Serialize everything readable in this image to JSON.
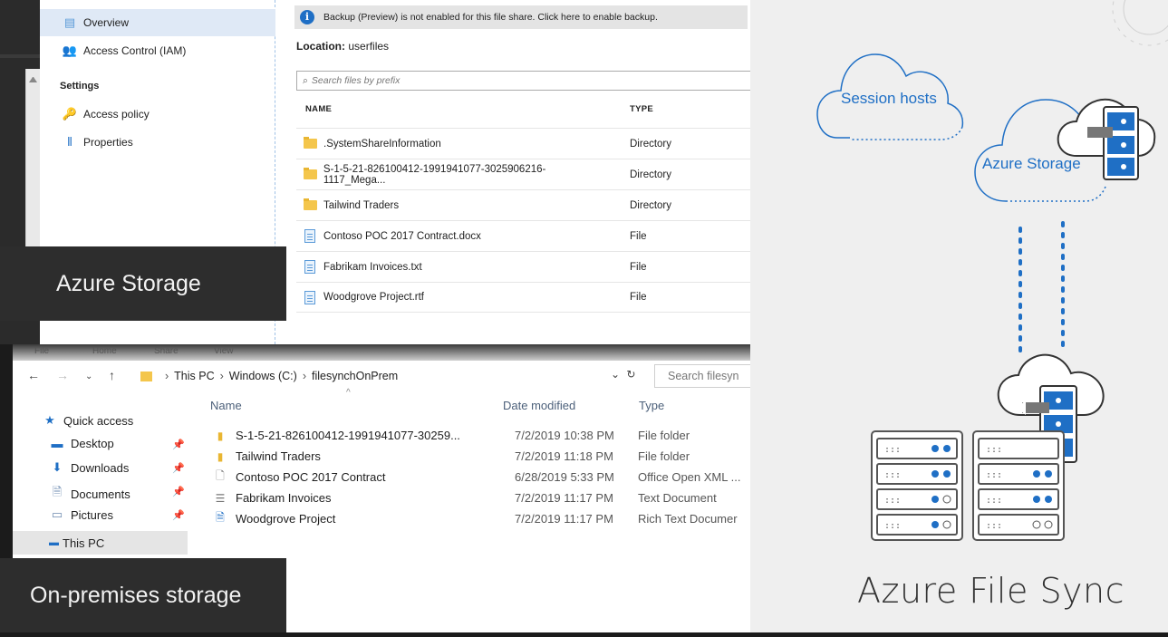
{
  "portal": {
    "nav": {
      "overview": "Overview",
      "iam": "Access Control (IAM)",
      "settings_heading": "Settings",
      "access_policy": "Access policy",
      "properties": "Properties"
    },
    "banner_text": "Backup (Preview) is not enabled for this file share. Click here to enable backup.",
    "location_label": "Location:",
    "location_value": "userfiles",
    "search_placeholder": "Search files by prefix",
    "columns": {
      "name": "NAME",
      "type": "TYPE"
    },
    "files": [
      {
        "name": ".SystemShareInformation",
        "type": "Directory",
        "icon": "folder-icon"
      },
      {
        "name": "S-1-5-21-826100412-1991941077-3025906216-1117_Mega...",
        "type": "Directory",
        "icon": "folder-icon"
      },
      {
        "name": "Tailwind Traders",
        "type": "Directory",
        "icon": "folder-icon"
      },
      {
        "name": "Contoso POC 2017 Contract.docx",
        "type": "File",
        "icon": "document-icon"
      },
      {
        "name": "Fabrikam Invoices.txt",
        "type": "File",
        "icon": "document-icon"
      },
      {
        "name": "Woodgrove Project.rtf",
        "type": "File",
        "icon": "document-icon"
      }
    ]
  },
  "label_azure": "Azure Storage",
  "explorer": {
    "ribbon": {
      "file": "File",
      "home": "Home",
      "share": "Share",
      "view": "View"
    },
    "path": {
      "this_pc": "This PC",
      "drive": "Windows (C:)",
      "folder": "filesynchOnPrem"
    },
    "search_placeholder": "Search filesyn",
    "nav": {
      "quick_access": "Quick access",
      "desktop": "Desktop",
      "downloads": "Downloads",
      "documents": "Documents",
      "pictures": "Pictures",
      "this_pc": "This PC"
    },
    "columns": {
      "name": "Name",
      "date": "Date modified",
      "type": "Type"
    },
    "files": [
      {
        "name": "S-1-5-21-826100412-1991941077-30259...",
        "date": "7/2/2019 10:38 PM",
        "type": "File folder"
      },
      {
        "name": "Tailwind Traders",
        "date": "7/2/2019 11:18 PM",
        "type": "File folder"
      },
      {
        "name": "Contoso POC 2017 Contract",
        "date": "6/28/2019 5:33 PM",
        "type": "Office Open XML ..."
      },
      {
        "name": "Fabrikam Invoices",
        "date": "7/2/2019 11:17 PM",
        "type": "Text Document"
      },
      {
        "name": "Woodgrove Project",
        "date": "7/2/2019 11:17 PM",
        "type": "Rich Text Documer"
      }
    ]
  },
  "label_onprem": "On-premises storage",
  "diagram": {
    "session_hosts": "Session hosts",
    "azure_storage": "Azure Storage",
    "title": "Azure File Sync",
    "accent_color": "#1f6fc5"
  }
}
